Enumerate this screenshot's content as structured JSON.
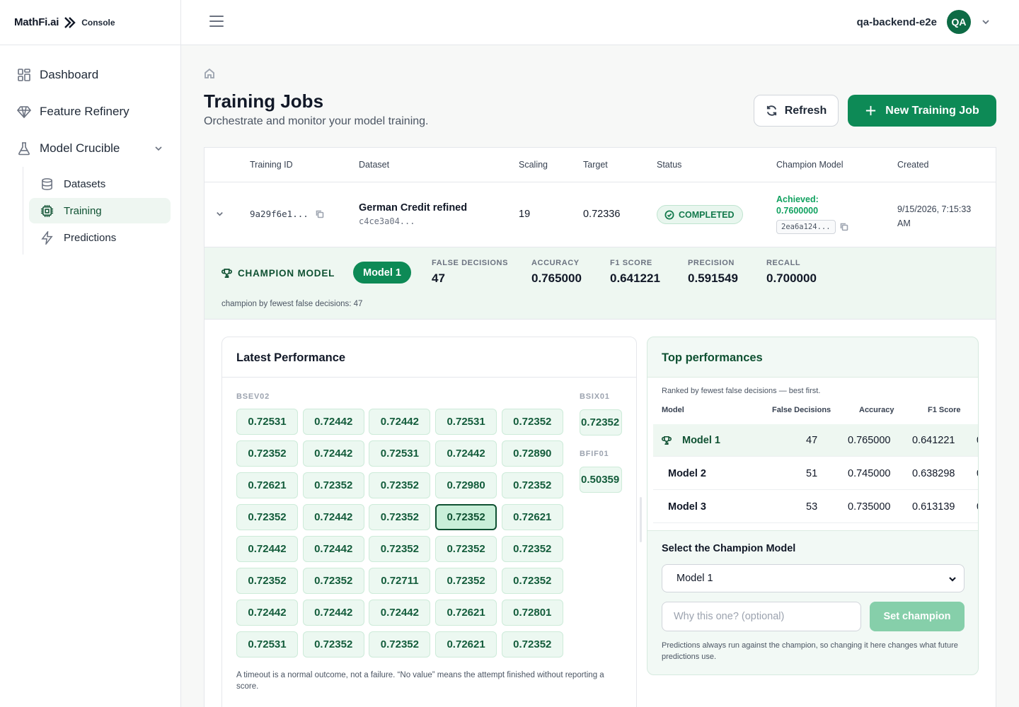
{
  "brand": {
    "name": "MathFi.ai",
    "suffix": "Console"
  },
  "sidebar": {
    "items": [
      {
        "label": "Dashboard"
      },
      {
        "label": "Feature Refinery"
      },
      {
        "label": "Model Crucible"
      }
    ],
    "sub_items": [
      {
        "label": "Datasets"
      },
      {
        "label": "Training",
        "active": true
      },
      {
        "label": "Predictions"
      }
    ]
  },
  "topbar": {
    "user_name": "qa-backend-e2e",
    "avatar_initials": "QA"
  },
  "page": {
    "title": "Training Jobs",
    "subtitle": "Orchestrate and monitor your model training.",
    "refresh_label": "Refresh",
    "new_job_label": "New Training Job"
  },
  "table": {
    "headers": [
      "Training ID",
      "Dataset",
      "Scaling",
      "Target",
      "Status",
      "Champion Model",
      "Created"
    ],
    "row": {
      "training_id": "9a29f6e1...",
      "dataset_name": "German Credit refined",
      "dataset_hash": "c4ce3a04...",
      "scaling": "19",
      "target": "0.72336",
      "status": "COMPLETED",
      "achieved_label": "Achieved:",
      "achieved_value": "0.7600000",
      "champion_hash": "2ea6a124...",
      "created_line1": "9/15/2026, 7:15:33",
      "created_line2": "AM"
    }
  },
  "champion": {
    "label": "CHAMPION MODEL",
    "model": "Model 1",
    "metrics": [
      {
        "key": "FALSE DECISIONS",
        "value": "47"
      },
      {
        "key": "ACCURACY",
        "value": "0.765000"
      },
      {
        "key": "F1 SCORE",
        "value": "0.641221"
      },
      {
        "key": "PRECISION",
        "value": "0.591549"
      },
      {
        "key": "RECALL",
        "value": "0.700000"
      }
    ],
    "note": "champion by fewest false decisions: 47"
  },
  "latest_performance": {
    "title": "Latest Performance",
    "groups": [
      {
        "label": "BSEV02",
        "rows": [
          [
            "0.72531",
            "0.72442",
            "0.72442",
            "0.72531",
            "0.72352"
          ],
          [
            "0.72352",
            "0.72442",
            "0.72531",
            "0.72442",
            "0.72890"
          ],
          [
            "0.72621",
            "0.72352",
            "0.72352",
            "0.72980",
            "0.72352"
          ],
          [
            "0.72352",
            "0.72442",
            "0.72352",
            "0.72352",
            "0.72621"
          ],
          [
            "0.72442",
            "0.72442",
            "0.72352",
            "0.72352",
            "0.72352"
          ],
          [
            "0.72352",
            "0.72352",
            "0.72711",
            "0.72352",
            "0.72352"
          ],
          [
            "0.72442",
            "0.72442",
            "0.72442",
            "0.72621",
            "0.72801"
          ],
          [
            "0.72531",
            "0.72352",
            "0.72352",
            "0.72621",
            "0.72352"
          ]
        ],
        "selected": [
          3,
          3
        ]
      },
      {
        "label": "BSIX01",
        "values": [
          "0.72352"
        ]
      },
      {
        "label": "BFIF01",
        "values": [
          "0.50359"
        ]
      }
    ],
    "note": "A timeout is a normal outcome, not a failure. “No value” means the attempt finished without reporting a score."
  },
  "top_performances": {
    "title": "Top performances",
    "hint": "Ranked by fewest false decisions — best first.",
    "headers": [
      "Model",
      "False Decisions",
      "Accuracy",
      "F1 Score"
    ],
    "rows": [
      {
        "model": "Model 1",
        "false_decisions": "47",
        "accuracy": "0.765000",
        "f1": "0.641221",
        "champion": true
      },
      {
        "model": "Model 2",
        "false_decisions": "51",
        "accuracy": "0.745000",
        "f1": "0.638298"
      },
      {
        "model": "Model 3",
        "false_decisions": "53",
        "accuracy": "0.735000",
        "f1": "0.613139"
      }
    ],
    "select_label": "Select the Champion Model",
    "selected_model": "Model 1",
    "reason_placeholder": "Why this one? (optional)",
    "set_button": "Set champion",
    "note": "Predictions always run against the champion, so changing it here changes what future predictions use."
  },
  "colors": {
    "brand_green": "#0d8a56",
    "champion_bg": "#eef7f1",
    "tile_bg": "#ecf8f1"
  }
}
